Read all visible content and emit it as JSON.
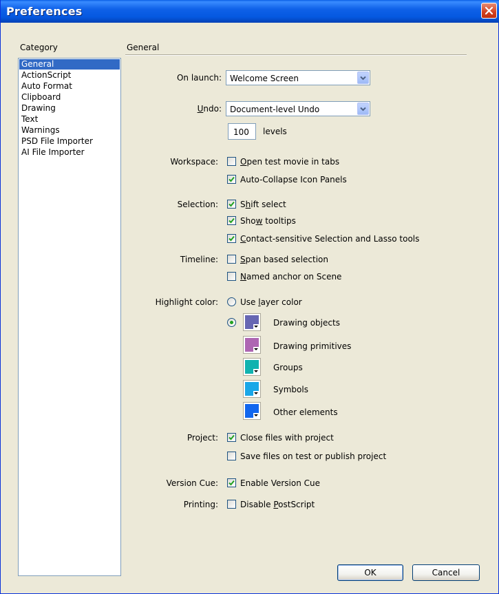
{
  "window": {
    "title": "Preferences"
  },
  "category": {
    "label": "Category",
    "items": [
      "General",
      "ActionScript",
      "Auto Format",
      "Clipboard",
      "Drawing",
      "Text",
      "Warnings",
      "PSD File Importer",
      "AI File Importer"
    ],
    "selected": "General"
  },
  "general": {
    "section_title": "General",
    "on_launch": {
      "label": "On launch:",
      "value": "Welcome Screen"
    },
    "undo": {
      "label": "Undo:",
      "value": "Document-level Undo",
      "levels_value": "100",
      "levels_label": "levels"
    },
    "workspace": {
      "label": "Workspace:",
      "options": [
        {
          "label": "Open test movie in tabs",
          "checked": false
        },
        {
          "label": "Auto-Collapse Icon Panels",
          "checked": true
        }
      ]
    },
    "selection": {
      "label": "Selection:",
      "options": [
        {
          "label": "Shift select",
          "checked": true
        },
        {
          "label": "Show tooltips",
          "checked": true
        },
        {
          "label": "Contact-sensitive Selection and Lasso tools",
          "checked": true
        }
      ]
    },
    "timeline": {
      "label": "Timeline:",
      "options": [
        {
          "label": "Span based selection",
          "checked": false
        },
        {
          "label": "Named anchor on Scene",
          "checked": false
        }
      ]
    },
    "highlight": {
      "label": "Highlight color:",
      "use_layer_color": "Use layer color",
      "items": [
        {
          "label": "Drawing objects",
          "color": "#6666B3"
        },
        {
          "label": "Drawing primitives",
          "color": "#AE66B3"
        },
        {
          "label": "Groups",
          "color": "#10B3B0"
        },
        {
          "label": "Symbols",
          "color": "#19A7E8"
        },
        {
          "label": "Other elements",
          "color": "#1166EE"
        }
      ]
    },
    "project": {
      "label": "Project:",
      "options": [
        {
          "label": "Close files with project",
          "checked": true
        },
        {
          "label": "Save files on test or publish project",
          "checked": false
        }
      ]
    },
    "version_cue": {
      "label": "Version Cue:",
      "option": "Enable Version Cue",
      "checked": true
    },
    "printing": {
      "label": "Printing:",
      "option": "Disable PostScript",
      "checked": false
    }
  },
  "buttons": {
    "ok": "OK",
    "cancel": "Cancel"
  }
}
